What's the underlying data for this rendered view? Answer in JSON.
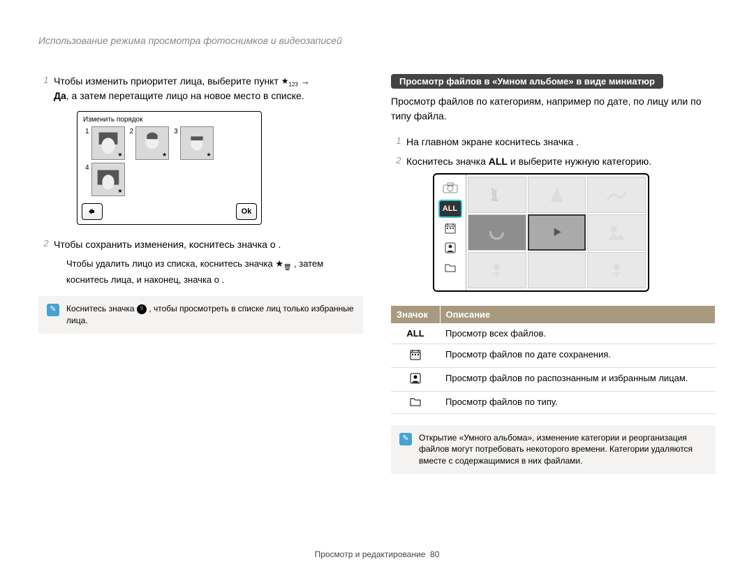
{
  "header": "Использование режима просмотра фотоснимков и видеозаписей",
  "left": {
    "step1_a": "Чтобы изменить приоритет лица, выберите пункт ",
    "step1_b_bold": "Да",
    "step1_c": ", а затем перетащите лицо на новое место в списке.",
    "arrow": "→",
    "panel_title": "Изменить порядок",
    "faces": [
      "1",
      "2",
      "3",
      "4"
    ],
    "ok": "Ok",
    "step2_a": "Чтобы сохранить изменения, коснитесь значка ",
    "step2_token": "o",
    "step2_c": ".",
    "subnote_a": "Чтобы удалить лицо из списка, коснитесь значка ",
    "subnote_b": ", затем коснитесь лица, и наконец, значка ",
    "subnote_token": "o",
    "subnote_c": ".",
    "info_a": "Коснитесь значка ",
    "info_b": ", чтобы просмотреть в списке лиц только избранные лица."
  },
  "right": {
    "pill": "Просмотр файлов в «Умном альбоме» в виде миниатюр",
    "intro": "Просмотр файлов по категориям, например по дате, по лицу или по типу файла.",
    "step1": "На главном экране коснитесь значка      .",
    "step2_a": "Коснитесь значка ",
    "step2_all": "ALL",
    "step2_b": " и выберите нужную категорию.",
    "side_all": "ALL",
    "table_head_icon": "Значок",
    "table_head_desc": "Описание",
    "rows": [
      {
        "icon": "ALL",
        "desc": "Просмотр всех файлов."
      },
      {
        "icon": "calendar",
        "desc": "Просмотр файлов по дате сохранения."
      },
      {
        "icon": "person",
        "desc": "Просмотр файлов по распознанным и избранным лицам."
      },
      {
        "icon": "folder",
        "desc": "Просмотр файлов по типу."
      }
    ],
    "info": "Открытие «Умного альбома», изменение категории и реорганизация файлов могут потребовать некоторого времени. Категории удаляются вместе с содержащимися в них файлами."
  },
  "footer": {
    "section": "Просмотр и редактирование",
    "page": "80"
  }
}
